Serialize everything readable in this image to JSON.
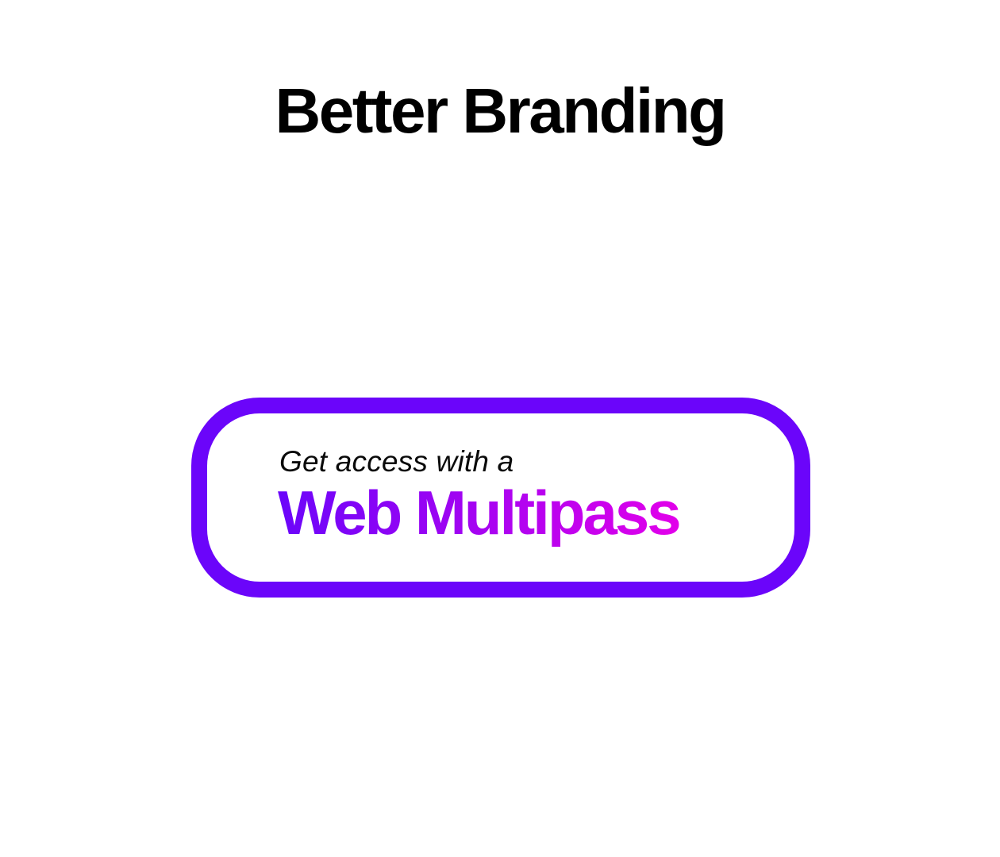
{
  "page": {
    "title": "Better Branding"
  },
  "multipass_button": {
    "lead_text": "Get access with a",
    "brand_text": "Web Multipass"
  },
  "colors": {
    "border": "#6b05fa",
    "gradient_start": "#6b05fa",
    "gradient_end": "#e200ea",
    "title": "#000000",
    "background": "#ffffff"
  }
}
